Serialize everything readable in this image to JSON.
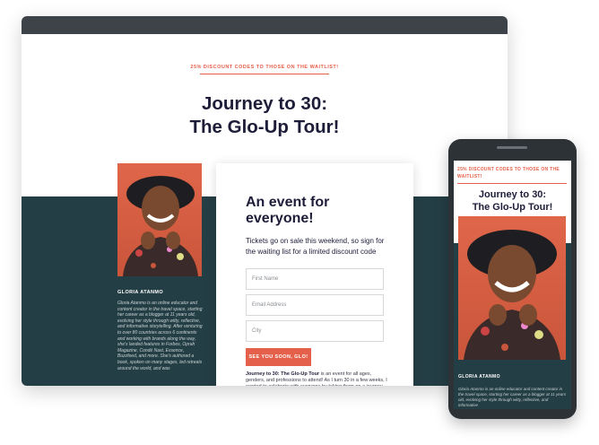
{
  "desktop": {
    "promo": "25% DISCOUNT CODES TO THOSE ON THE WAITLIST!",
    "title_line1": "Journey to 30:",
    "title_line2": "The Glo-Up Tour!",
    "bio": {
      "name": "GLORIA ATANMO",
      "text": "Gloria Atanmo is an online educator and content creator in the travel space, starting her career as a blogger at 11 years old, evolving her style through witty, reflective, and informative storytelling. After venturing to over 80 countries across 6 continents and working with brands along the way, she's landed features in Forbes, Oprah Magazine, Condé Nast, Essence, Buzzfeed, and more. She's authored a book, spoken on many stages, led retreats around the world, and was"
    },
    "card": {
      "heading": "An event for everyone!",
      "subtext": "Tickets go on sale this weekend, so sign for the waiting list for a limited discount code",
      "fields": {
        "first_name_placeholder": "First Name",
        "email_placeholder": "Email Address",
        "city_placeholder": "City"
      },
      "cta_label": "SEE YOU SOON, GLO!",
      "desc_bold": "Journey to 30: The Glo-Up Tour",
      "desc_rest": " is an event for all ages, genders, and professions to attend! As I turn 30 in a few weeks, I wanted to celebrate with everyone by taking them on a journey of my last 30 years to share my biggest lessons, and pull back the curtains on everything I have planned for this next chapter, year, and decade! Also my"
    }
  },
  "phone": {
    "promo": "25% DISCOUNT CODES TO THOSE ON THE WAITLIST!",
    "title_line1": "Journey to 30:",
    "title_line2": "The Glo-Up Tour!",
    "bio_name": "GLORIA ATANMO",
    "bio_text": "Gloria Atanmo is an online educator and content creator in the travel space, starting her career as a blogger at 11 years old, evolving her style through witty, reflective, and informative"
  },
  "colors": {
    "accent": "#e5604a",
    "dark_teal": "#243e45",
    "title": "#1d1d3a"
  }
}
